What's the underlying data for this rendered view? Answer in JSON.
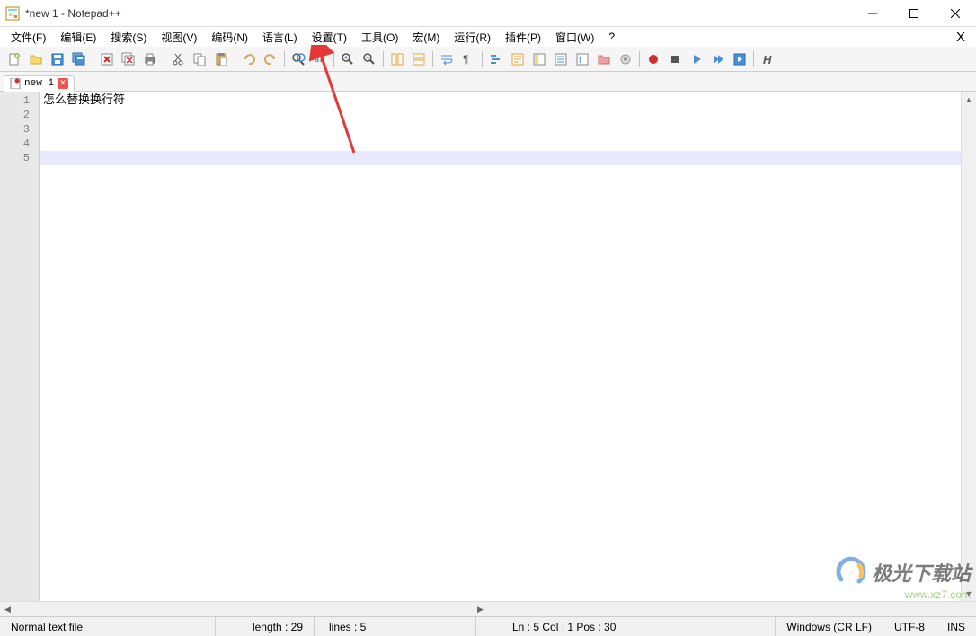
{
  "titlebar": {
    "title": "*new 1 - Notepad++"
  },
  "menubar": {
    "items": [
      "文件(F)",
      "编辑(E)",
      "搜索(S)",
      "视图(V)",
      "编码(N)",
      "语言(L)",
      "设置(T)",
      "工具(O)",
      "宏(M)",
      "运行(R)",
      "插件(P)",
      "窗口(W)",
      "?"
    ]
  },
  "toolbar": {
    "groups": [
      [
        "new",
        "open",
        "save",
        "save-all"
      ],
      [
        "close",
        "close-all",
        "print"
      ],
      [
        "cut",
        "copy",
        "paste"
      ],
      [
        "undo",
        "redo"
      ],
      [
        "find",
        "replace"
      ],
      [
        "zoom-in",
        "zoom-out"
      ],
      [
        "sync-v",
        "sync-h"
      ],
      [
        "wrap",
        "all-chars"
      ],
      [
        "indent",
        "lang",
        "doc-map",
        "func-list",
        "folder"
      ],
      [
        "monitor"
      ],
      [
        "record",
        "stop",
        "play",
        "play-multi",
        "save-macro"
      ],
      [
        "bold"
      ]
    ]
  },
  "tab": {
    "label": "new 1"
  },
  "editor": {
    "line_count": 5,
    "current_line_index": 4,
    "lines": [
      "怎么替换换行符",
      "",
      "",
      "",
      ""
    ]
  },
  "statusbar": {
    "filetype": "Normal text file",
    "length_label": "length : 29",
    "lines_label": "lines : 5",
    "pos_label": "Ln : 5    Col : 1    Pos : 30",
    "eol": "Windows (CR LF)",
    "encoding": "UTF-8",
    "mode": "INS"
  },
  "watermark": {
    "brand": "极光下载站",
    "url": "www.xz7.com"
  }
}
